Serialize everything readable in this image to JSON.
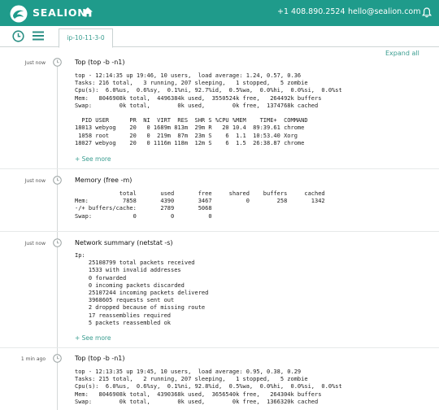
{
  "navbar": {
    "brand": "SEALION",
    "phone": "+1 408.890.2524",
    "email": "hello@sealion.com",
    "background": "#1f9b8b"
  },
  "toolbar": {
    "tab_label": "ip-10-11-3-0"
  },
  "expand_all": "Expand all",
  "entries": [
    {
      "time": "Just now",
      "title": "Top (top -b -n1)",
      "output": "top - 12:14:35 up 19:46, 10 users,  load average: 1.24, 0.57, 0.36\nTasks: 216 total,   3 running, 207 sleeping,   1 stopped,   5 zombie\nCpu(s):  6.0%us,  0.6%sy,  0.1%ni, 92.7%id,  0.5%wa,  0.0%hi,  0.0%si,  0.0%st\nMem:   8046908k total,  4496384k used,  3550524k free,   264492k buffers\nSwap:        0k total,        0k used,        0k free,  1374768k cached\n\n  PID USER      PR  NI  VIRT  RES  SHR S %CPU %MEM    TIME+  COMMAND\n18013 webyog    20   0 1689m 813m  29m R   20 10.4  89:39.61 chrome\n 1058 root      20   0  219m  87m  23m S    6  1.1  10:53.40 Xorg\n18027 webyog    20   0 1116m 118m  12m S    6  1.5  26:38.87 chrome",
      "see_more": "+ See more"
    },
    {
      "time": "Just now",
      "title": "Memory (free -m)",
      "output": "             total       used       free     shared    buffers     cached\nMem:          7858       4390       3467          0        258       1342\n-/+ buffers/cache:       2789       5068\nSwap:            0          0          0"
    },
    {
      "time": "Just now",
      "title": "Network summary (netstat -s)",
      "output": "Ip:\n    25108799 total packets received\n    1533 with invalid addresses\n    0 forwarded\n    0 incoming packets discarded\n    25107244 incoming packets delivered\n    3968605 requests sent out\n    2 dropped because of missing route\n    17 reassemblies required\n    5 packets reassembled ok",
      "see_more": "+ See more"
    },
    {
      "time": "1 min ago",
      "title": "Top (top -b -n1)",
      "output": "top - 12:13:35 up 19:45, 10 users,  load average: 0.95, 0.38, 0.29\nTasks: 215 total,   2 running, 207 sleeping,   1 stopped,   5 zombie\nCpu(s):  6.0%us,  0.6%sy,  0.1%ni, 92.8%id,  0.5%wa,  0.0%hi,  0.0%si,  0.0%st\nMem:   8046908k total,  4390368k used,  3656540k free,   264304k buffers\nSwap:        0k total,        0k used,        0k free,  1366320k cached"
    }
  ]
}
